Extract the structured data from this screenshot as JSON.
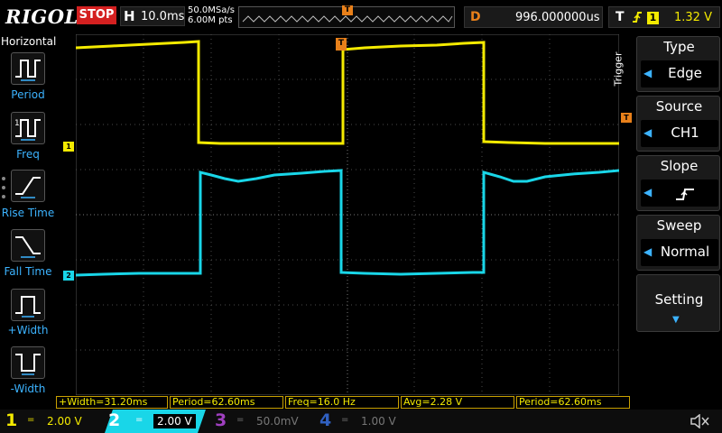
{
  "top": {
    "brand": "RIGOL",
    "run_state": "STOP",
    "horiz_label": "H",
    "timebase": "10.0ms",
    "sample_rate": "50.0MSa/s",
    "memory_depth": "6.00M pts",
    "trig_marker": "T",
    "delay_label": "D",
    "delay_value": "996.000000us",
    "trig_label": "T",
    "trig_edge_icon": "rising-edge-icon",
    "trig_source_num": "1",
    "trig_level": "1.32 V"
  },
  "left_menu": {
    "title": "Horizontal",
    "items": [
      {
        "label": "Period",
        "icon": "period-icon"
      },
      {
        "label": "Freq",
        "icon": "freq-icon"
      },
      {
        "label": "Rise Time",
        "icon": "rise-time-icon"
      },
      {
        "label": "Fall Time",
        "icon": "fall-time-icon"
      },
      {
        "label": "+Width",
        "icon": "pos-width-icon"
      },
      {
        "label": "-Width",
        "icon": "neg-width-icon"
      }
    ]
  },
  "markers": {
    "ch1": "1",
    "ch2": "2",
    "trig": "T"
  },
  "trigger_menu": {
    "side_label": "Trigger",
    "type_title": "Type",
    "type_value": "Edge",
    "source_title": "Source",
    "source_value": "CH1",
    "slope_title": "Slope",
    "sweep_title": "Sweep",
    "sweep_value": "Normal",
    "setting_title": "Setting"
  },
  "measurements": [
    "+Width=31.20ms",
    "Period=62.60ms",
    "Freq=16.0 Hz",
    "Avg=2.28 V",
    "Period=62.60ms"
  ],
  "channels": [
    {
      "num": "1",
      "coupling": "=",
      "scale": "2.00 V",
      "color": "#f4ea00",
      "active": true
    },
    {
      "num": "2",
      "coupling": "=",
      "scale": "2.00 V",
      "color": "#19d6e8",
      "active": true
    },
    {
      "num": "3",
      "coupling": "=",
      "scale": "50.0mV",
      "color": "#a040c0",
      "active": false
    },
    {
      "num": "4",
      "coupling": "=",
      "scale": "1.00 V",
      "color": "#3060c0",
      "active": false
    }
  ],
  "colors": {
    "ch1": "#f4ea00",
    "ch2": "#19d6e8",
    "trigger": "#e8801a",
    "stop": "#d42020",
    "accent": "#3cb3ff"
  }
}
